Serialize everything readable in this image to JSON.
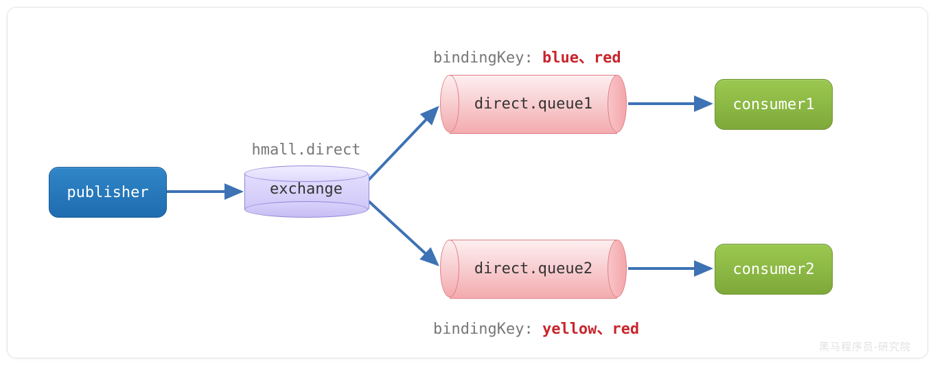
{
  "publisher": {
    "label": "publisher"
  },
  "exchange": {
    "name": "hmall.direct",
    "label": "exchange"
  },
  "queues": {
    "q1": {
      "label": "direct.queue1",
      "binding_label": "bindingKey: ",
      "binding_keys": "blue、red"
    },
    "q2": {
      "label": "direct.queue2",
      "binding_label": "bindingKey: ",
      "binding_keys": "yellow、red"
    }
  },
  "consumers": {
    "c1": {
      "label": "consumer1"
    },
    "c2": {
      "label": "consumer2"
    }
  },
  "watermark": "黑马程序员-研究院",
  "colors": {
    "arrow": "#3d72b4",
    "publisher_bg": "#2f86c7",
    "exchange_bg": "#e0d9fc",
    "queue_bg": "#f8c5c8",
    "consumer_bg": "#9bc850",
    "binding_key_text": "#c8252d",
    "label_gray": "#777777"
  },
  "chart_data": {
    "type": "flow-diagram",
    "nodes": [
      {
        "id": "publisher",
        "kind": "producer",
        "label": "publisher"
      },
      {
        "id": "exchange",
        "kind": "exchange",
        "label": "exchange",
        "name": "hmall.direct",
        "exchange_type": "direct"
      },
      {
        "id": "queue1",
        "kind": "queue",
        "label": "direct.queue1",
        "binding_keys": [
          "blue",
          "red"
        ]
      },
      {
        "id": "queue2",
        "kind": "queue",
        "label": "direct.queue2",
        "binding_keys": [
          "yellow",
          "red"
        ]
      },
      {
        "id": "consumer1",
        "kind": "consumer",
        "label": "consumer1"
      },
      {
        "id": "consumer2",
        "kind": "consumer",
        "label": "consumer2"
      }
    ],
    "edges": [
      {
        "from": "publisher",
        "to": "exchange"
      },
      {
        "from": "exchange",
        "to": "queue1"
      },
      {
        "from": "exchange",
        "to": "queue2"
      },
      {
        "from": "queue1",
        "to": "consumer1"
      },
      {
        "from": "queue2",
        "to": "consumer2"
      }
    ]
  }
}
